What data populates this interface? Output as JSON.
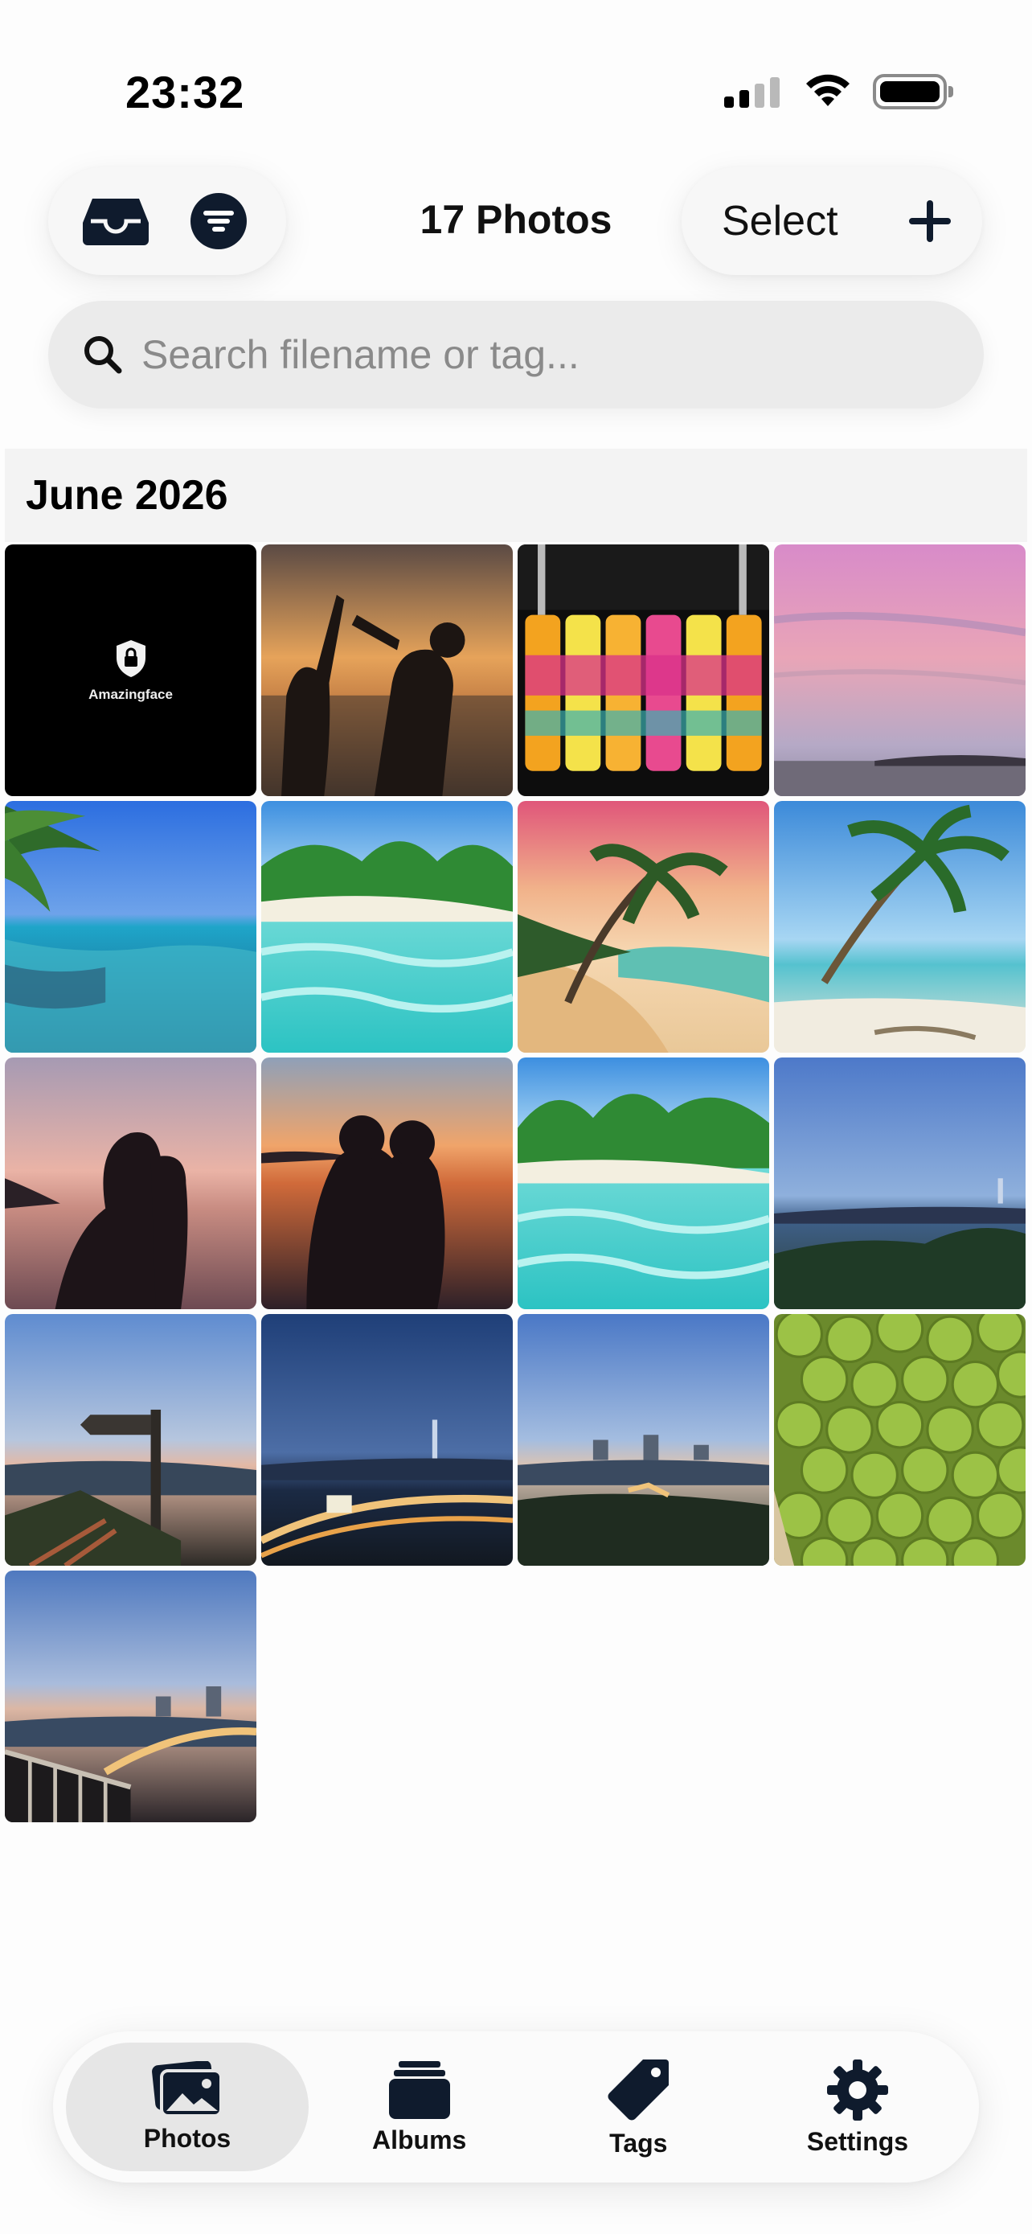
{
  "status_bar": {
    "time": "23:32"
  },
  "header": {
    "title": "17 Photos",
    "select_label": "Select"
  },
  "search": {
    "placeholder": "Search filename or tag..."
  },
  "sections": [
    {
      "title": "June 2026",
      "locked_label": "Amazingface"
    }
  ],
  "tabs": [
    {
      "label": "Photos",
      "icon": "photos-icon",
      "active": true
    },
    {
      "label": "Albums",
      "icon": "albums-icon",
      "active": false
    },
    {
      "label": "Tags",
      "icon": "tag-icon",
      "active": false
    },
    {
      "label": "Settings",
      "icon": "gear-icon",
      "active": false
    }
  ],
  "colors": {
    "accent": "#111111",
    "search_bg": "#ebebeb",
    "active_tab_bg": "#e6e6e6"
  }
}
